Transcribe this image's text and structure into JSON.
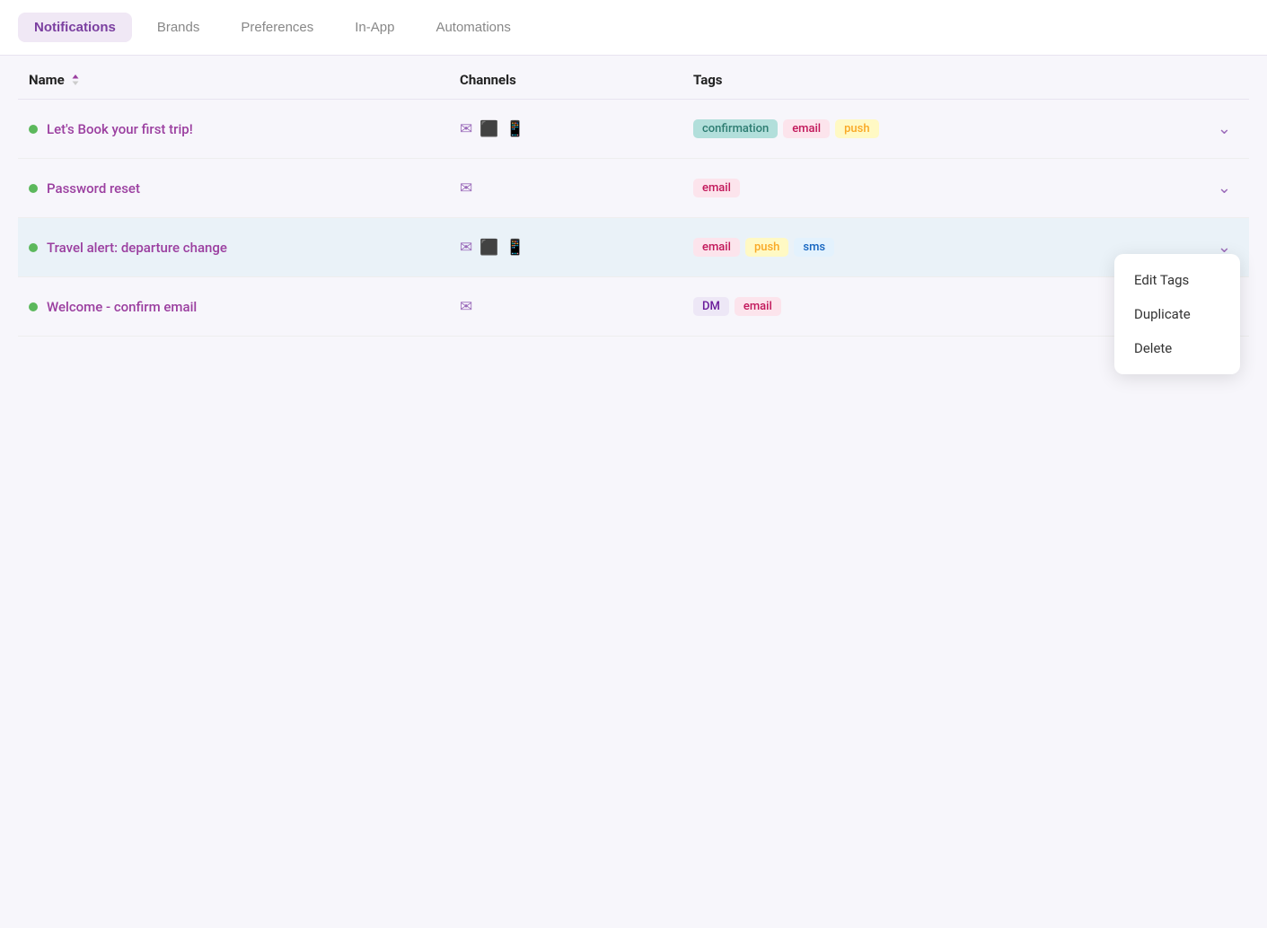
{
  "nav": {
    "tabs": [
      {
        "id": "notifications",
        "label": "Notifications",
        "active": true
      },
      {
        "id": "brands",
        "label": "Brands",
        "active": false
      },
      {
        "id": "preferences",
        "label": "Preferences",
        "active": false
      },
      {
        "id": "in-app",
        "label": "In-App",
        "active": false
      },
      {
        "id": "automations",
        "label": "Automations",
        "active": false
      }
    ]
  },
  "table": {
    "headers": {
      "name": "Name",
      "channels": "Channels",
      "tags": "Tags"
    },
    "rows": [
      {
        "id": "row1",
        "name": "Let's Book your first trip!",
        "channels": [
          "email",
          "desktop",
          "mobile"
        ],
        "tags": [
          {
            "label": "confirmation",
            "style": "tag-confirmation"
          },
          {
            "label": "email",
            "style": "tag-email-green"
          },
          {
            "label": "push",
            "style": "tag-push"
          }
        ],
        "highlighted": false
      },
      {
        "id": "row2",
        "name": "Password reset",
        "channels": [
          "email"
        ],
        "tags": [
          {
            "label": "email",
            "style": "tag-email-pink"
          }
        ],
        "highlighted": false
      },
      {
        "id": "row3",
        "name": "Travel alert: departure change",
        "channels": [
          "email",
          "desktop",
          "mobile"
        ],
        "tags": [
          {
            "label": "email",
            "style": "tag-email-row3"
          },
          {
            "label": "push",
            "style": "tag-push-row3"
          },
          {
            "label": "sms",
            "style": "tag-sms"
          }
        ],
        "highlighted": true,
        "dropdown_open": true
      },
      {
        "id": "row4",
        "name": "Welcome - confirm email",
        "channels": [
          "email"
        ],
        "tags": [
          {
            "label": "DM",
            "style": "tag-dm"
          },
          {
            "label": "email",
            "style": "tag-email-row4"
          }
        ],
        "highlighted": false
      }
    ],
    "dropdown": {
      "items": [
        "Edit Tags",
        "Duplicate",
        "Delete"
      ]
    }
  }
}
